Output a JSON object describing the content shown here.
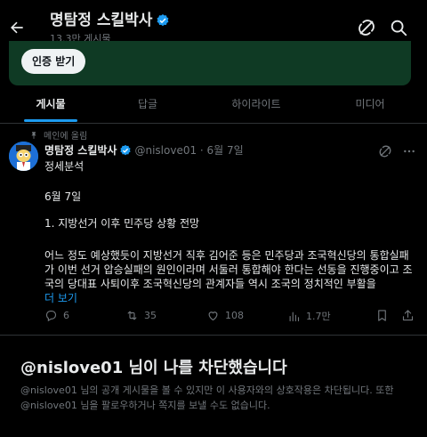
{
  "header": {
    "title": "명탐정 스킬박사",
    "subtitle": "13.3만 게시물"
  },
  "banner": {
    "button_label": "인증 받기"
  },
  "tabs": [
    {
      "label": "게시물",
      "active": true
    },
    {
      "label": "답글",
      "active": false
    },
    {
      "label": "하이라이트",
      "active": false
    },
    {
      "label": "미디어",
      "active": false
    }
  ],
  "pinned_label": "메인에 올림",
  "post": {
    "name": "명탐정 스킬박사",
    "handle": "@nislove01 · 6월 7일",
    "lines": [
      "정세분석",
      "6월 7일",
      "1. 지방선거 이후 민주당 상황 전망",
      "어느 정도 예상했듯이 지방선거 직후 김어준 등은 민주당과 조국혁신당의 통합실패가 이번 선거 압승실패의 원인이라며 서둘러 통합해야 한다는 선동을 진행중이고 조국의 당대표 사퇴이후 조국혁신당의 관계자들 역시 조국의 정치적인 부활을"
    ],
    "more_label": "더 보기",
    "counts": {
      "replies": "6",
      "reposts": "35",
      "likes": "108",
      "views": "1.7만"
    }
  },
  "block": {
    "title": "@nislove01 님이 나를 차단했습니다",
    "description": "@nislove01 님의 공개 게시물을 볼 수 있지만 이 사용자와의 상호작용은 차단됩니다. 또한 @nislove01 님을 팔로우하거나 쪽지를 보낼 수도 없습니다."
  },
  "colors": {
    "accent": "#1d9bf0",
    "banner": "#0f3a24",
    "background": "#000000"
  },
  "icons": [
    "back-arrow-icon",
    "verified-badge-icon",
    "grok-icon",
    "search-icon",
    "pin-icon",
    "more-icon",
    "reply-icon",
    "repost-icon",
    "like-icon",
    "views-icon",
    "bookmark-icon",
    "share-icon"
  ]
}
